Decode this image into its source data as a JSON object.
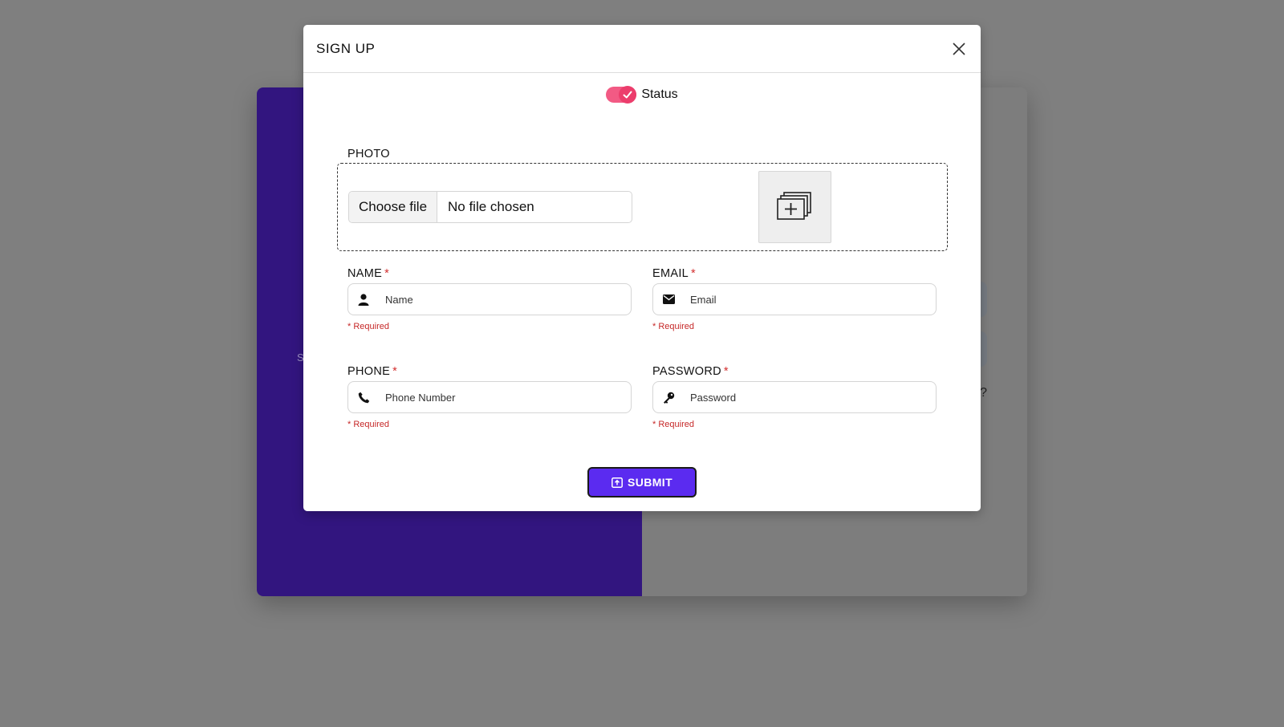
{
  "background": {
    "left_panel_ghost_text": "S",
    "right_panel_ghost_text": "?"
  },
  "modal": {
    "title": "SIGN UP",
    "status": {
      "label": "Status",
      "checked": true
    },
    "photo": {
      "label": "PHOTO",
      "choose_button": "Choose file",
      "file_status": "No file chosen"
    },
    "fields": {
      "name": {
        "label": "NAME",
        "required_mark": "*",
        "placeholder": "Name",
        "note": "* Required",
        "icon": "user-icon"
      },
      "email": {
        "label": "EMAIL",
        "required_mark": "*",
        "placeholder": "Email",
        "note": "* Required",
        "icon": "envelope-icon"
      },
      "phone": {
        "label": "PHONE",
        "required_mark": "*",
        "placeholder": "Phone Number",
        "note": "* Required",
        "icon": "phone-icon"
      },
      "password": {
        "label": "PASSWORD",
        "required_mark": "*",
        "placeholder": "Password",
        "note": "* Required",
        "icon": "key-icon"
      }
    },
    "submit_label": "SUBMIT"
  },
  "colors": {
    "overlay": "#7f7f7f",
    "left_panel": "#32157f",
    "toggle": "#ec3d6c",
    "submit": "#5b2bf0",
    "required": "#d32f2f"
  }
}
